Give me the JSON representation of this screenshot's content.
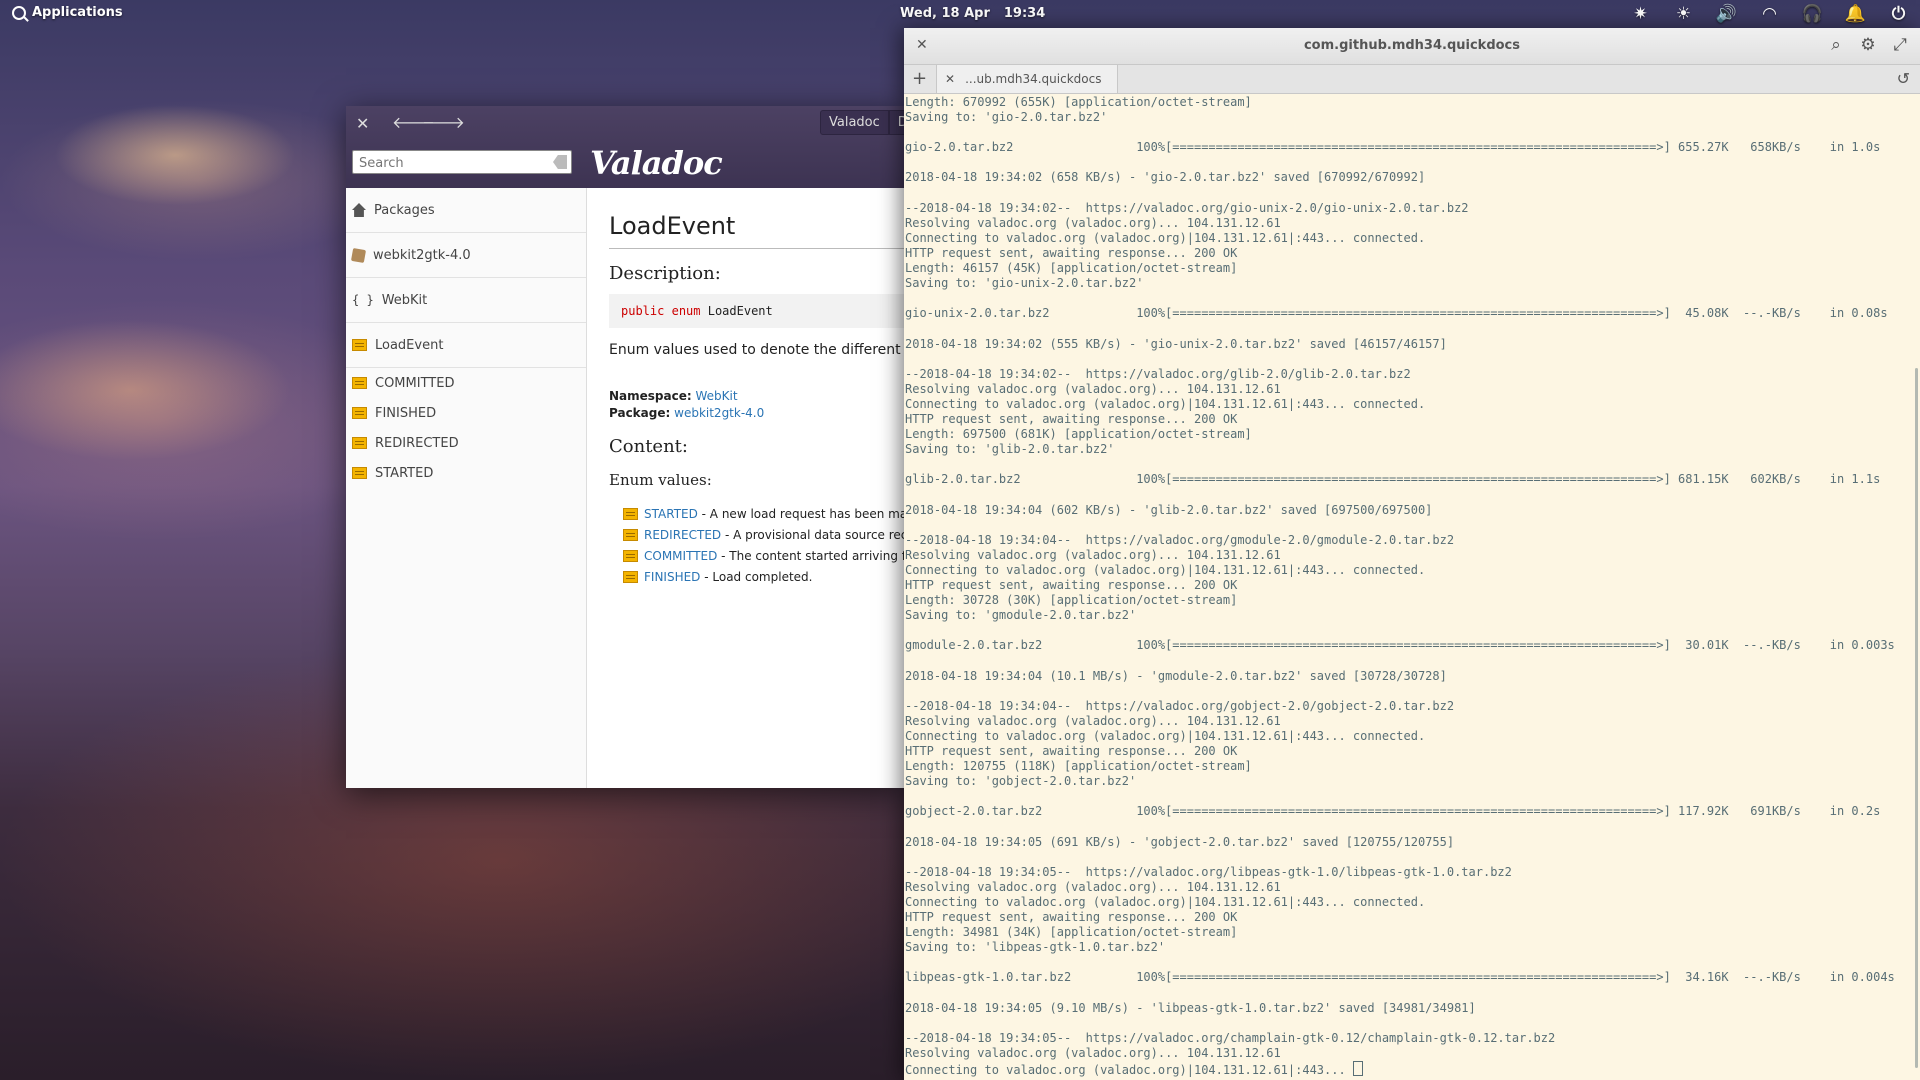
{
  "panel": {
    "apps_label": "Applications",
    "date": "Wed, 18 Apr",
    "time": "19:34",
    "indicators": [
      {
        "name": "gear-icon",
        "glyph": "✷"
      },
      {
        "name": "brightness-icon",
        "glyph": "☀"
      },
      {
        "name": "volume-icon",
        "glyph": "🔊"
      },
      {
        "name": "wifi-icon",
        "glyph": "◠"
      },
      {
        "name": "headphones-icon",
        "glyph": "🎧"
      },
      {
        "name": "bell-icon",
        "glyph": "🔔"
      },
      {
        "name": "power-icon",
        "glyph": "⏻"
      }
    ]
  },
  "valadoc": {
    "tab1": "Valadoc",
    "tab2": "De",
    "search_placeholder": "Search",
    "logo": "Valadoc",
    "sidebar": {
      "packages": "Packages",
      "package": "webkit2gtk-4.0",
      "namespace": "WebKit",
      "enum": "LoadEvent",
      "values": [
        "COMMITTED",
        "FINISHED",
        "REDIRECTED",
        "STARTED"
      ]
    },
    "content": {
      "title": "LoadEvent",
      "description_heading": "Description:",
      "code_kw1": "public",
      "code_kw2": "enum",
      "code_name": "LoadEvent",
      "description": "Enum values used to denote the different e",
      "namespace_label": "Namespace:",
      "namespace_value": "WebKit",
      "package_label": "Package:",
      "package_value": "webkit2gtk-4.0",
      "content_heading": "Content:",
      "enum_values_heading": "Enum values:",
      "enum_values": [
        {
          "name": "STARTED",
          "desc": " - A new load request has been made"
        },
        {
          "name": "REDIRECTED",
          "desc": " - A provisional data source receiv"
        },
        {
          "name": "COMMITTED",
          "desc": " - The content started arriving for"
        },
        {
          "name": "FINISHED",
          "desc": " - Load completed."
        }
      ]
    }
  },
  "terminal": {
    "title": "com.github.mdh34.quickdocs",
    "tab_label": "...ub.mdh34.quickdocs",
    "lines": [
      "Length: 670992 (655K) [application/octet-stream]",
      "Saving to: 'gio-2.0.tar.bz2'",
      "",
      "gio-2.0.tar.bz2                 100%[===================================================================>] 655.27K   658KB/s    in 1.0s",
      "",
      "2018-04-18 19:34:02 (658 KB/s) - 'gio-2.0.tar.bz2' saved [670992/670992]",
      "",
      "--2018-04-18 19:34:02--  https://valadoc.org/gio-unix-2.0/gio-unix-2.0.tar.bz2",
      "Resolving valadoc.org (valadoc.org)... 104.131.12.61",
      "Connecting to valadoc.org (valadoc.org)|104.131.12.61|:443... connected.",
      "HTTP request sent, awaiting response... 200 OK",
      "Length: 46157 (45K) [application/octet-stream]",
      "Saving to: 'gio-unix-2.0.tar.bz2'",
      "",
      "gio-unix-2.0.tar.bz2            100%[===================================================================>]  45.08K  --.-KB/s    in 0.08s",
      "",
      "2018-04-18 19:34:02 (555 KB/s) - 'gio-unix-2.0.tar.bz2' saved [46157/46157]",
      "",
      "--2018-04-18 19:34:02--  https://valadoc.org/glib-2.0/glib-2.0.tar.bz2",
      "Resolving valadoc.org (valadoc.org)... 104.131.12.61",
      "Connecting to valadoc.org (valadoc.org)|104.131.12.61|:443... connected.",
      "HTTP request sent, awaiting response... 200 OK",
      "Length: 697500 (681K) [application/octet-stream]",
      "Saving to: 'glib-2.0.tar.bz2'",
      "",
      "glib-2.0.tar.bz2                100%[===================================================================>] 681.15K   602KB/s    in 1.1s",
      "",
      "2018-04-18 19:34:04 (602 KB/s) - 'glib-2.0.tar.bz2' saved [697500/697500]",
      "",
      "--2018-04-18 19:34:04--  https://valadoc.org/gmodule-2.0/gmodule-2.0.tar.bz2",
      "Resolving valadoc.org (valadoc.org)... 104.131.12.61",
      "Connecting to valadoc.org (valadoc.org)|104.131.12.61|:443... connected.",
      "HTTP request sent, awaiting response... 200 OK",
      "Length: 30728 (30K) [application/octet-stream]",
      "Saving to: 'gmodule-2.0.tar.bz2'",
      "",
      "gmodule-2.0.tar.bz2             100%[===================================================================>]  30.01K  --.-KB/s    in 0.003s",
      "",
      "2018-04-18 19:34:04 (10.1 MB/s) - 'gmodule-2.0.tar.bz2' saved [30728/30728]",
      "",
      "--2018-04-18 19:34:04--  https://valadoc.org/gobject-2.0/gobject-2.0.tar.bz2",
      "Resolving valadoc.org (valadoc.org)... 104.131.12.61",
      "Connecting to valadoc.org (valadoc.org)|104.131.12.61|:443... connected.",
      "HTTP request sent, awaiting response... 200 OK",
      "Length: 120755 (118K) [application/octet-stream]",
      "Saving to: 'gobject-2.0.tar.bz2'",
      "",
      "gobject-2.0.tar.bz2             100%[===================================================================>] 117.92K   691KB/s    in 0.2s",
      "",
      "2018-04-18 19:34:05 (691 KB/s) - 'gobject-2.0.tar.bz2' saved [120755/120755]",
      "",
      "--2018-04-18 19:34:05--  https://valadoc.org/libpeas-gtk-1.0/libpeas-gtk-1.0.tar.bz2",
      "Resolving valadoc.org (valadoc.org)... 104.131.12.61",
      "Connecting to valadoc.org (valadoc.org)|104.131.12.61|:443... connected.",
      "HTTP request sent, awaiting response... 200 OK",
      "Length: 34981 (34K) [application/octet-stream]",
      "Saving to: 'libpeas-gtk-1.0.tar.bz2'",
      "",
      "libpeas-gtk-1.0.tar.bz2         100%[===================================================================>]  34.16K  --.-KB/s    in 0.004s",
      "",
      "2018-04-18 19:34:05 (9.10 MB/s) - 'libpeas-gtk-1.0.tar.bz2' saved [34981/34981]",
      "",
      "--2018-04-18 19:34:05--  https://valadoc.org/champlain-gtk-0.12/champlain-gtk-0.12.tar.bz2",
      "Resolving valadoc.org (valadoc.org)... 104.131.12.61"
    ],
    "last_line": "Connecting to valadoc.org (valadoc.org)|104.131.12.61|:443... "
  }
}
